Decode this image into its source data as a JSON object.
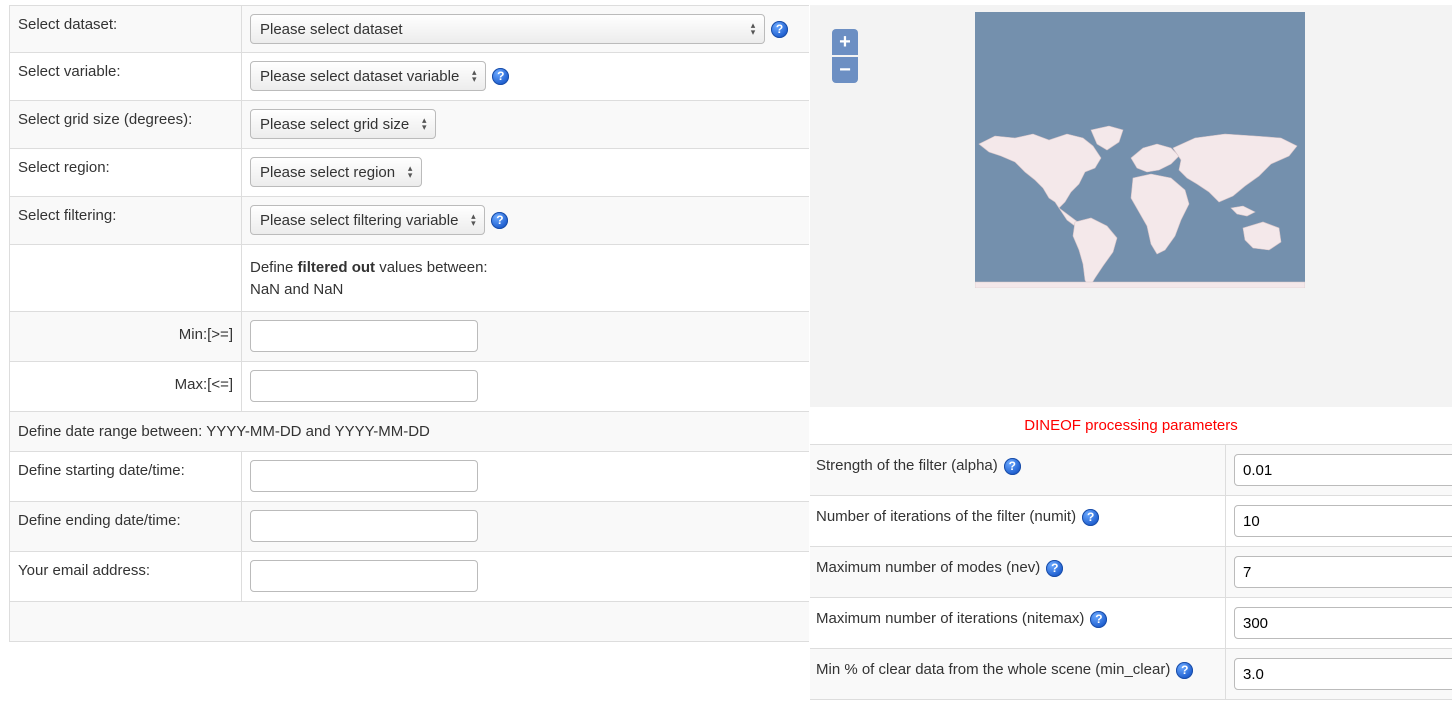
{
  "form": {
    "dataset": {
      "label": "Select dataset:",
      "value": "Please select dataset"
    },
    "variable": {
      "label": "Select variable:",
      "value": "Please select dataset variable"
    },
    "grid": {
      "label": "Select grid size (degrees):",
      "value": "Please select grid size"
    },
    "region": {
      "label": "Select region:",
      "value": "Please select region"
    },
    "filtering": {
      "label": "Select filtering:",
      "value": "Please select filtering variable"
    },
    "filter_note": {
      "prefix": "Define ",
      "bold": "filtered out",
      "suffix": " values between:",
      "range": "NaN and NaN"
    },
    "min": {
      "label": "Min:[>=]",
      "value": ""
    },
    "max": {
      "label": "Max:[<=]",
      "value": ""
    },
    "date_range_note": "Define date range between: YYYY-MM-DD and YYYY-MM-DD",
    "start": {
      "label": "Define starting date/time:",
      "value": ""
    },
    "end": {
      "label": "Define ending date/time:",
      "value": ""
    },
    "email": {
      "label": "Your email address:",
      "value": ""
    }
  },
  "map": {
    "zoom_in": "+",
    "zoom_out": "−",
    "ocean_color": "#7490ad",
    "land_color": "#f4e8ea"
  },
  "params": {
    "title": "DINEOF processing parameters",
    "title_color": "#ff0000",
    "rows": [
      {
        "label": "Strength of the filter (alpha)",
        "value": "0.01"
      },
      {
        "label": "Number of iterations of the filter (numit)",
        "value": "10"
      },
      {
        "label": "Maximum number of modes (nev)",
        "value": "7"
      },
      {
        "label": "Maximum number of iterations (nitemax)",
        "value": "300"
      },
      {
        "label": "Min % of clear data from the whole scene (min_clear)",
        "value": "3.0"
      }
    ]
  },
  "help_glyph": "?",
  "select_arrows": "▲▼"
}
